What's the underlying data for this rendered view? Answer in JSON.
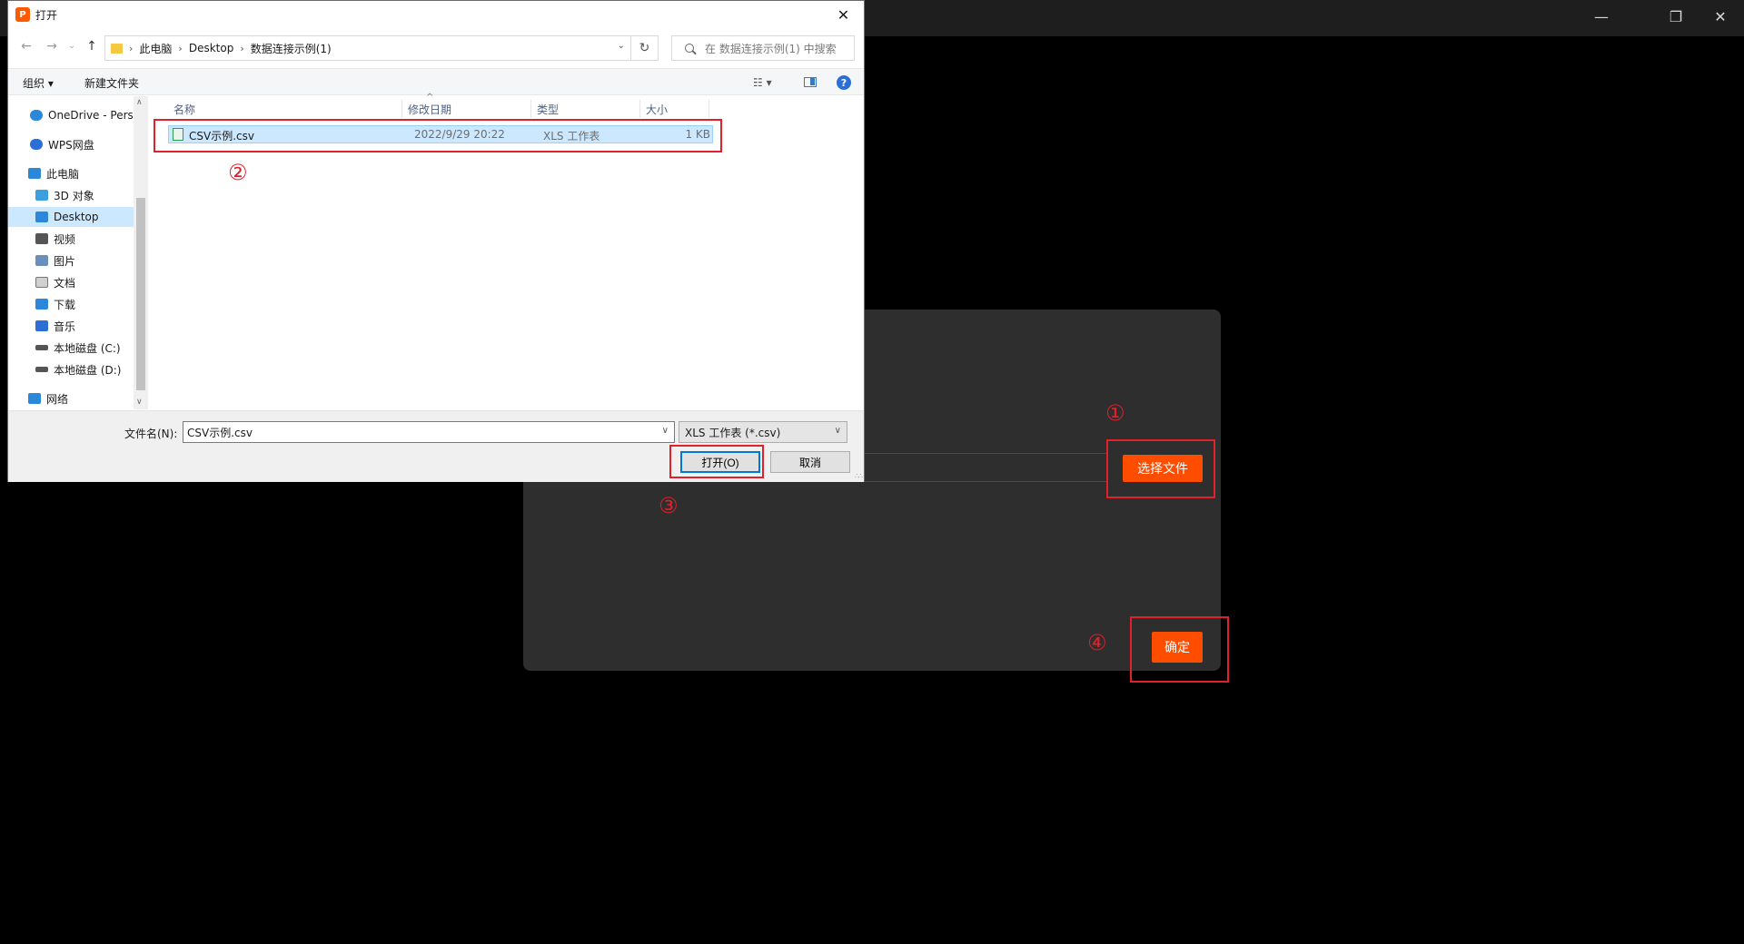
{
  "app": {
    "window_controls": {
      "minimize": "—",
      "maximize": "❐",
      "close": "✕"
    },
    "modal": {
      "choose_file_label": "选择文件",
      "confirm_label": "确定"
    },
    "annotations": {
      "n1": "①",
      "n2": "②",
      "n3": "③",
      "n4": "④"
    }
  },
  "dialog": {
    "title": "打开",
    "app_icon_glyph": "P",
    "close_glyph": "✕",
    "nav": {
      "back": "←",
      "forward": "→",
      "dropdown": "⌄",
      "up": "↑"
    },
    "breadcrumbs": [
      "此电脑",
      "Desktop",
      "数据连接示例(1)"
    ],
    "search_placeholder": "在 数据连接示例(1) 中搜索",
    "commands": {
      "organize": "组织 ▾",
      "new_folder": "新建文件夹"
    },
    "sidebar": [
      {
        "label": "OneDrive - Perso",
        "icon": "cloud-icon",
        "color": "#2b88d8"
      },
      {
        "label": "WPS网盘",
        "icon": "cloud-icon",
        "color": "#2b6fd6"
      },
      {
        "label": "此电脑",
        "icon": "computer-icon",
        "color": "#2b88d8"
      },
      {
        "label": "3D 对象",
        "icon": "cube-icon",
        "color": "#3aa0e0"
      },
      {
        "label": "Desktop",
        "icon": "desktop-icon",
        "color": "#2b88d8"
      },
      {
        "label": "视频",
        "icon": "film-icon",
        "color": "#555555"
      },
      {
        "label": "图片",
        "icon": "picture-icon",
        "color": "#6a8fb8"
      },
      {
        "label": "文档",
        "icon": "document-icon",
        "color": "#777777"
      },
      {
        "label": "下载",
        "icon": "download-icon",
        "color": "#2b88d8"
      },
      {
        "label": "音乐",
        "icon": "music-icon",
        "color": "#2b6fd6"
      },
      {
        "label": "本地磁盘 (C:)",
        "icon": "drive-icon",
        "color": "#555555"
      },
      {
        "label": "本地磁盘 (D:)",
        "icon": "drive-icon",
        "color": "#555555"
      },
      {
        "label": "网络",
        "icon": "network-icon",
        "color": "#2b88d8"
      }
    ],
    "columns": [
      "名称",
      "修改日期",
      "类型",
      "大小"
    ],
    "files": [
      {
        "name": "CSV示例.csv",
        "modified": "2022/9/29 20:22",
        "type": "XLS 工作表",
        "size": "1 KB"
      }
    ],
    "filename_label": "文件名(N):",
    "filename_value": "CSV示例.csv",
    "filetype_value": "XLS 工作表 (*.csv)",
    "open_label": "打开(O)",
    "cancel_label": "取消"
  },
  "colors": {
    "accent_orange": "#ff4d00",
    "annotation_red": "#e0202a",
    "selection_blue": "#cce8ff"
  }
}
